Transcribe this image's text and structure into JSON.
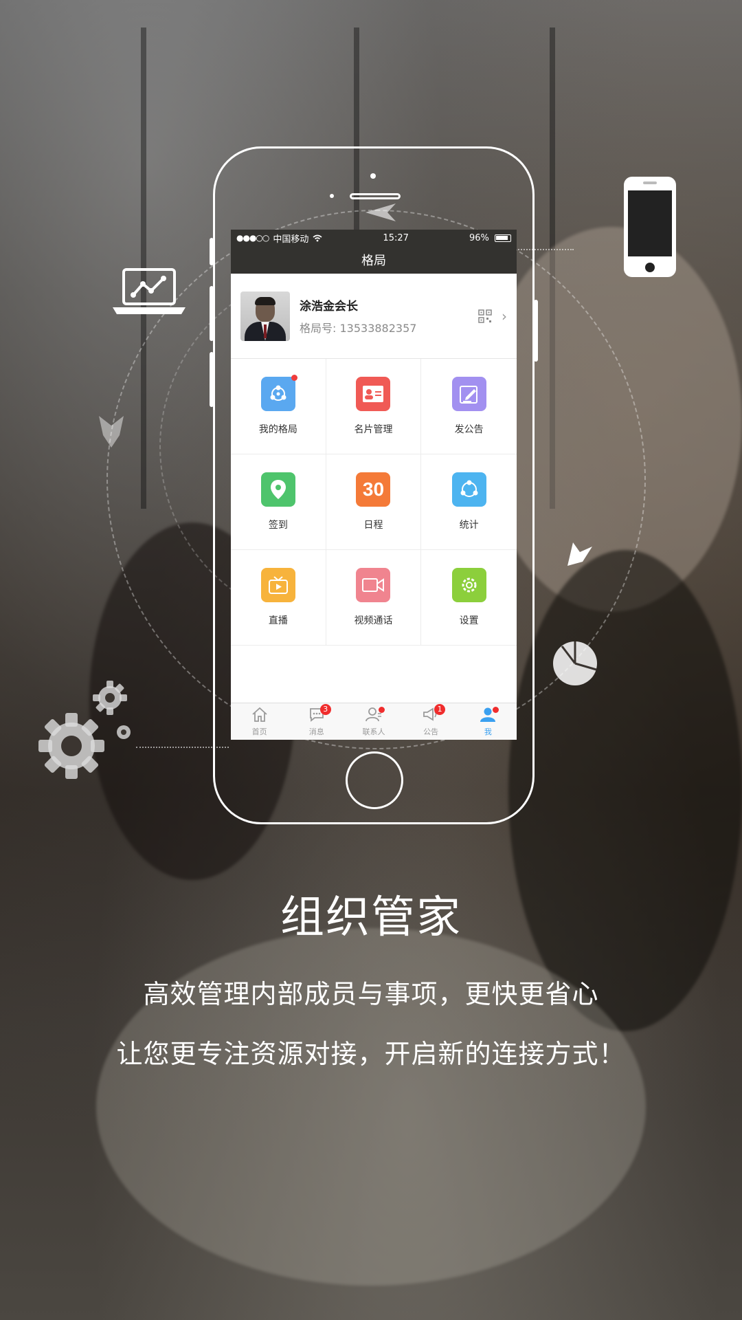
{
  "status_bar": {
    "carrier": "中国移动",
    "time": "15:27",
    "battery": "96%"
  },
  "nav": {
    "title": "格局"
  },
  "profile": {
    "name": "涂浩金会长",
    "id_text": "格局号: 13533882357"
  },
  "grid": [
    {
      "label": "我的格局",
      "icon": "network-icon",
      "color": "#5aa8f0",
      "dot": true
    },
    {
      "label": "名片管理",
      "icon": "business-card-icon",
      "color": "#f05a55",
      "dot": false
    },
    {
      "label": "发公告",
      "icon": "edit-notice-icon",
      "color": "#a290f0",
      "dot": false
    },
    {
      "label": "签到",
      "icon": "location-pin-icon",
      "color": "#4ec46c",
      "dot": false
    },
    {
      "label": "日程",
      "icon": "calendar-icon",
      "color": "#f47a38",
      "dot": false,
      "text": "30"
    },
    {
      "label": "统计",
      "icon": "statistics-icon",
      "color": "#4db4f0",
      "dot": false
    },
    {
      "label": "直播",
      "icon": "live-tv-icon",
      "color": "#f7b33c",
      "dot": false
    },
    {
      "label": "视频通话",
      "icon": "video-call-icon",
      "color": "#f0848f",
      "dot": false
    },
    {
      "label": "设置",
      "icon": "settings-icon",
      "color": "#8ccf3c",
      "dot": false
    }
  ],
  "tabs": [
    {
      "label": "首页",
      "icon": "home-icon",
      "badge": ""
    },
    {
      "label": "消息",
      "icon": "message-icon",
      "badge": "3"
    },
    {
      "label": "联系人",
      "icon": "contacts-icon",
      "badge": ""
    },
    {
      "label": "公告",
      "icon": "megaphone-icon",
      "badge": "1"
    },
    {
      "label": "我",
      "icon": "user-icon",
      "badge": "",
      "active": true
    }
  ],
  "headline": "组织管家",
  "taglines": [
    "高效管理内部成员与事项，更快更省心",
    "让您更专注资源对接，开启新的连接方式！"
  ],
  "colors": {
    "accent_blue": "#3aa0f0",
    "badge_red": "#f02d2d",
    "nav_dark": "#33322f"
  }
}
